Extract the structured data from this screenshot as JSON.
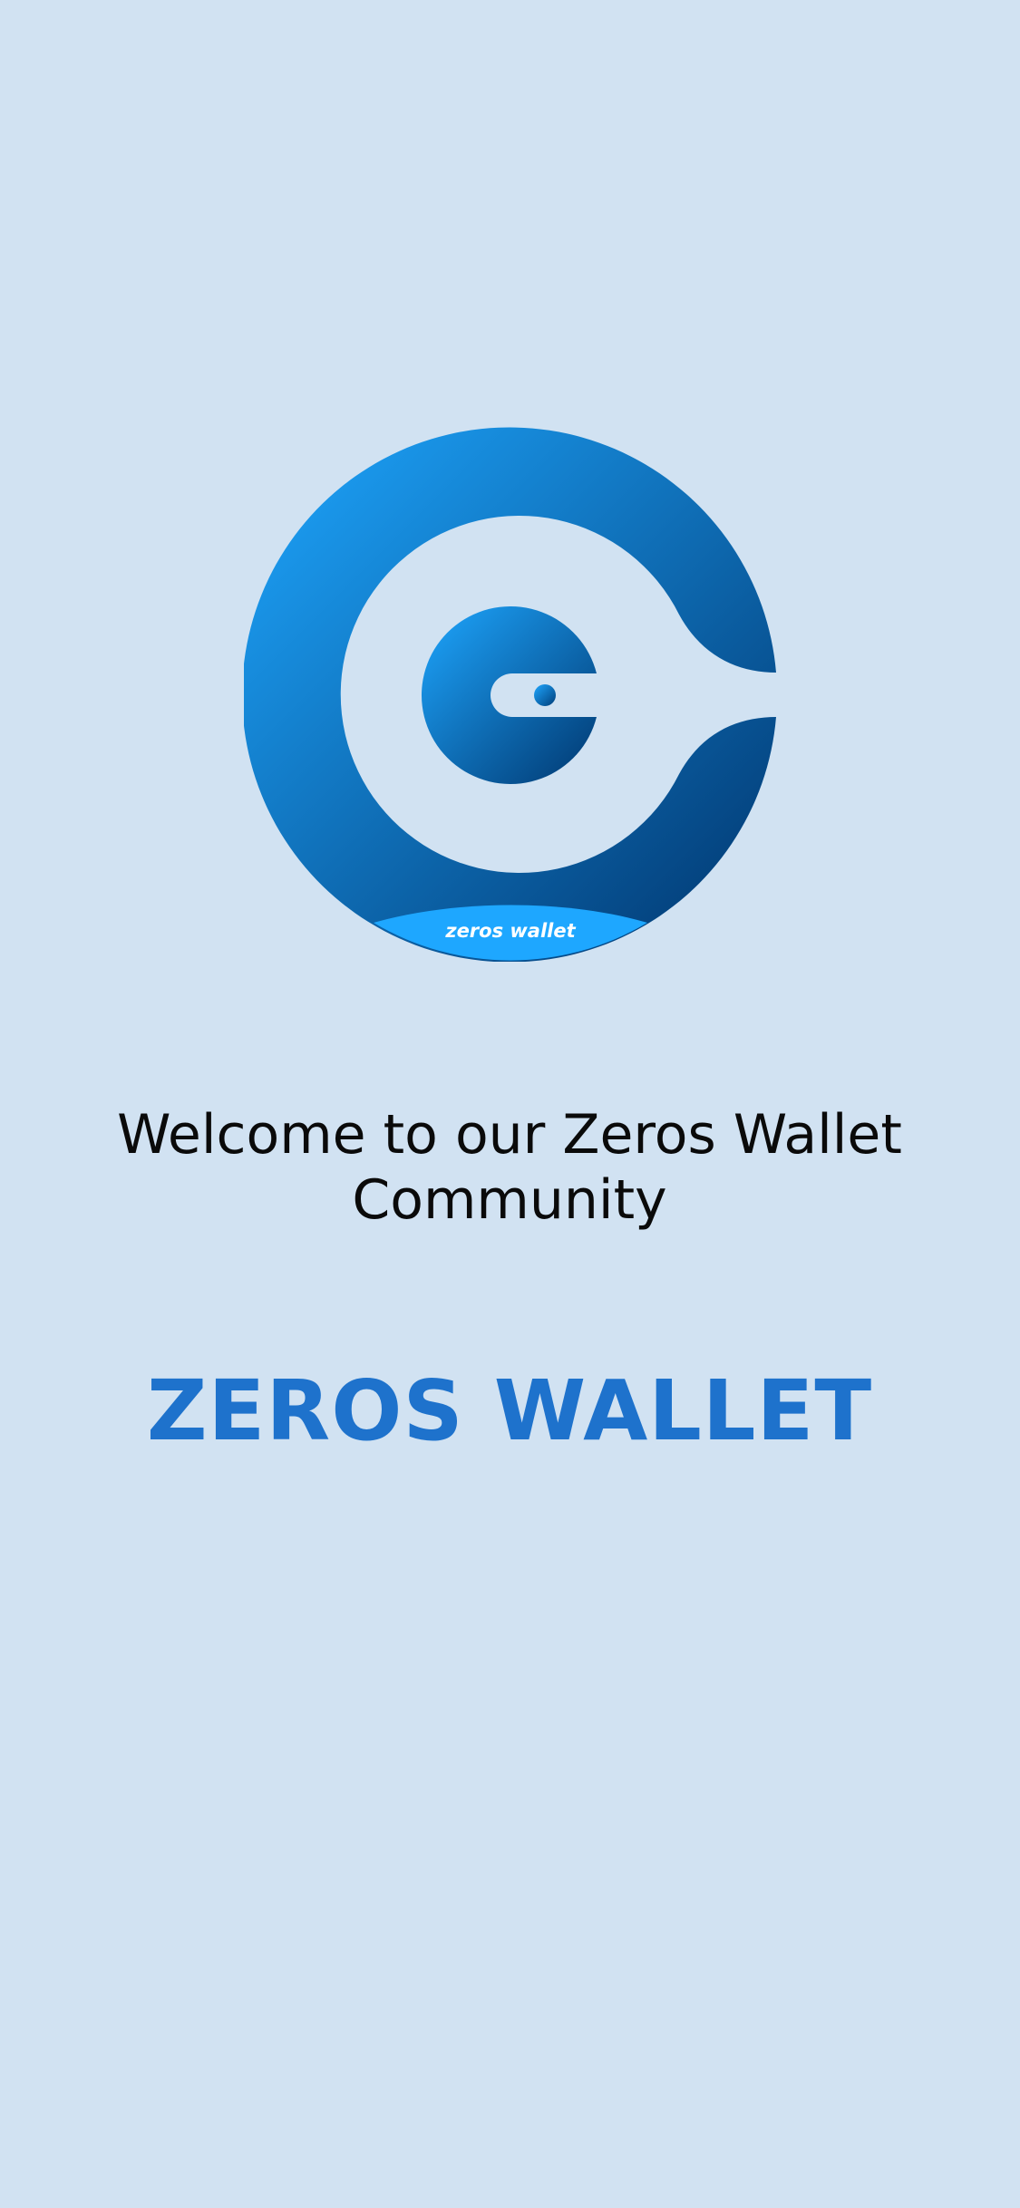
{
  "logo": {
    "icon": "zeros-wallet-logo-icon",
    "caption": "zeros wallet"
  },
  "welcome_text": "Welcome to our Zeros Wallet Community",
  "brand_title": "ZEROS WALLET",
  "colors": {
    "background": "#d1e2f2",
    "brand_blue": "#1e72cc",
    "logo_light": "#1ea7ff",
    "logo_dark": "#003770"
  }
}
